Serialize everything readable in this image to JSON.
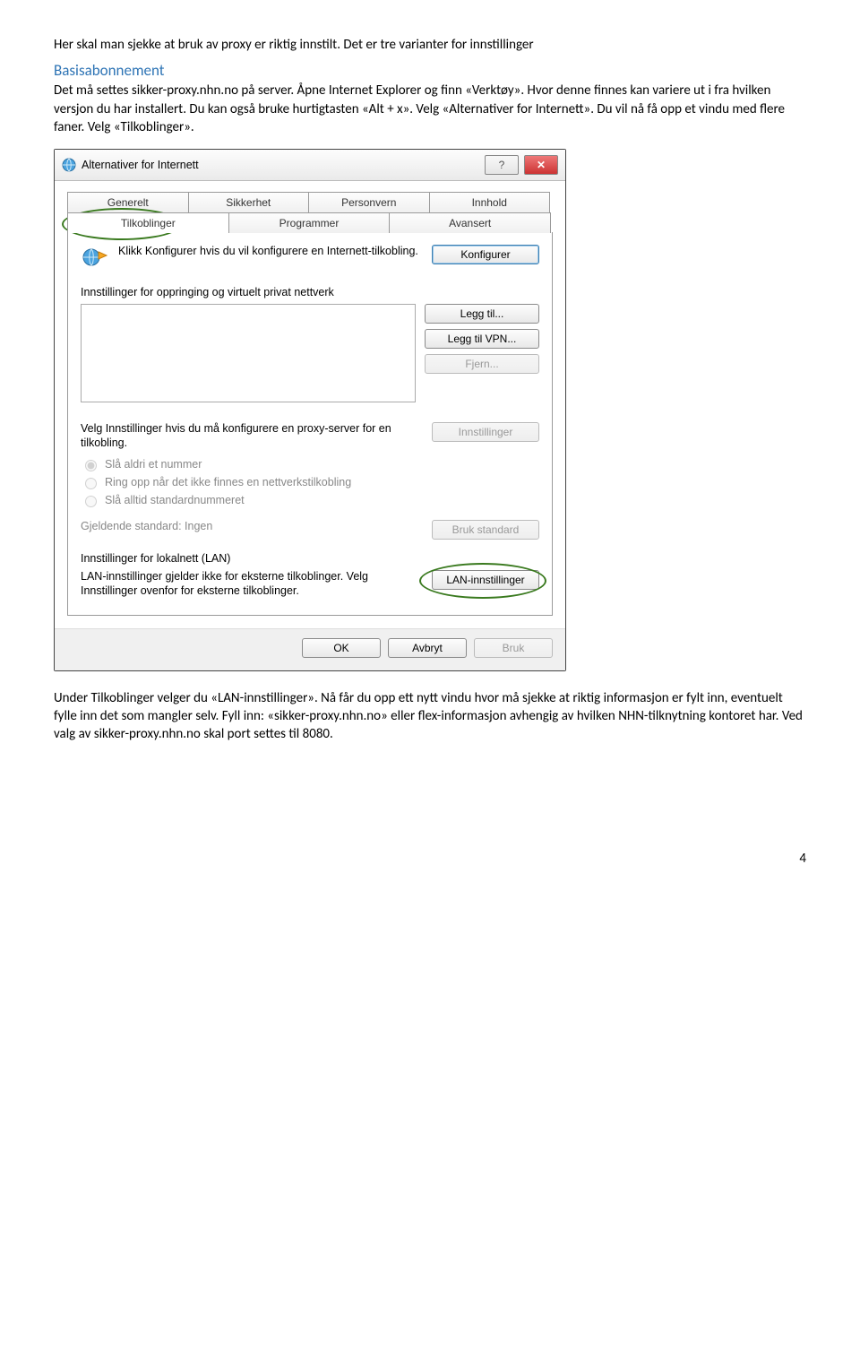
{
  "intro": "Her skal man sjekke at bruk av proxy er riktig innstilt. Det er tre varianter for innstillinger",
  "heading": "Basisabonnement",
  "body": "Det må settes sikker-proxy.nhn.no på server. Åpne Internet Explorer og finn «Verktøy». Hvor denne finnes kan variere ut i fra hvilken versjon du har installert. Du kan også bruke hurtigtasten «Alt + x». Velg «Alternativer for Internett». Du vil nå få opp et vindu med flere faner. Velg «Tilkoblinger».",
  "dialog": {
    "title": "Alternativer for Internett",
    "help": "?",
    "close": "✕",
    "tabs": {
      "generelt": "Generelt",
      "sikkerhet": "Sikkerhet",
      "personvern": "Personvern",
      "innhold": "Innhold",
      "tilkoblinger": "Tilkoblinger",
      "programmer": "Programmer",
      "avansert": "Avansert"
    },
    "konfig_text": "Klikk Konfigurer hvis du vil konfigurere en Internett-tilkobling.",
    "konfigurer": "Konfigurer",
    "group_dial": "Innstillinger for oppringing og virtuelt privat nettverk",
    "buttons": {
      "legg_til": "Legg til...",
      "legg_til_vpn": "Legg til VPN...",
      "fjern": "Fjern...",
      "innstillinger": "Innstillinger",
      "bruk_standard": "Bruk standard",
      "lan": "LAN-innstillinger",
      "ok": "OK",
      "avbryt": "Avbryt",
      "bruk": "Bruk"
    },
    "proxy_text": "Velg Innstillinger hvis du må konfigurere en proxy-server for en tilkobling.",
    "radios": {
      "r1": "Slå aldri et nummer",
      "r2": "Ring opp når det ikke finnes en nettverkstilkobling",
      "r3": "Slå alltid standardnummeret"
    },
    "gjeldende": "Gjeldende standard:   Ingen",
    "group_lan": "Innstillinger for lokalnett (LAN)",
    "lan_text": "LAN-innstillinger gjelder ikke for eksterne tilkoblinger. Velg Innstillinger ovenfor for eksterne tilkoblinger."
  },
  "outro": "Under Tilkoblinger velger du «LAN-innstillinger». Nå får du opp ett nytt vindu hvor må sjekke at riktig informasjon er fylt inn, eventuelt fylle inn det som mangler selv. Fyll inn: «sikker-proxy.nhn.no» eller flex-informasjon avhengig av hvilken NHN-tilknytning kontoret har. Ved valg av sikker-proxy.nhn.no skal port settes til 8080.",
  "page_num": "4"
}
